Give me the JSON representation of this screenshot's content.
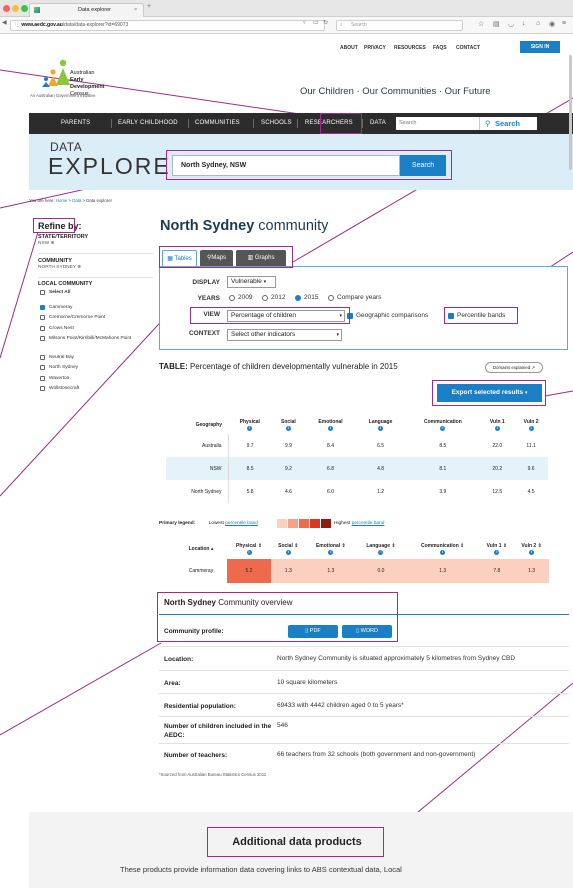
{
  "browser": {
    "tab_title": "Data explorer",
    "url": "www.aedc.gov.au/data/data-explorer?id=69073",
    "url_host": "www.aedc.gov.au",
    "url_path": "/data/data-explorer?id=69073",
    "search_placeholder": "Search"
  },
  "site": {
    "logo_lines": [
      "Australian",
      "Early",
      "Development",
      "Census"
    ],
    "gov_initiative": "An Australian Government Initiative",
    "top_links": [
      "ABOUT",
      "PRIVACY",
      "RESOURCES",
      "FAQS",
      "CONTACT"
    ],
    "sign_in": "SIGN IN",
    "tagline": "Our Children · Our Communities · Our Future",
    "nav": [
      "PARENTS",
      "EARLY CHILDHOOD",
      "COMMUNITIES",
      "SCHOOLS",
      "RESEARCHERS",
      "DATA"
    ],
    "nav_search_placeholder": "Search",
    "nav_search_button": "Search"
  },
  "hero": {
    "title_small": "DATA",
    "title_large": "EXPLORER",
    "search_value": "North Sydney, NSW",
    "search_button": "Search"
  },
  "breadcrumb": {
    "prefix": "You are here:",
    "items": [
      "Home",
      "Data",
      "Data explorer"
    ],
    "sep": " > "
  },
  "sidebar": {
    "title": "Refine by:",
    "state_label": "STATE/TERRITORY",
    "state_value": "NSW",
    "community_label": "COMMUNITY",
    "community_value": "NORTH SYDNEY",
    "local_label": "LOCAL COMMUNITY",
    "local_items": [
      {
        "label": "Select All",
        "checked": false
      },
      {
        "label": "Cammeray",
        "checked": true
      },
      {
        "label": "Cremorne/Cremorne Point",
        "checked": false
      },
      {
        "label": "Crows Nest",
        "checked": false
      },
      {
        "label": "Milsons Point/Kirribilli/McMahons Point",
        "checked": false
      },
      {
        "label": "Neutral Bay",
        "checked": false
      },
      {
        "label": "North Sydney",
        "checked": false
      },
      {
        "label": "Waverton",
        "checked": false
      },
      {
        "label": "Wollstonecraft",
        "checked": false
      }
    ]
  },
  "main": {
    "title_bold": "North Sydney",
    "title_rest": " community",
    "view_tabs": [
      {
        "label": "Tables",
        "icon": "table-icon",
        "active": true
      },
      {
        "label": "Maps",
        "icon": "map-pin-icon",
        "active": false
      },
      {
        "label": "Graphs",
        "icon": "bar-chart-icon",
        "active": false
      }
    ],
    "filters": {
      "display_label": "DISPLAY",
      "display_value": "Vulnerable",
      "years_label": "YEARS",
      "years": [
        {
          "label": "2009",
          "selected": false
        },
        {
          "label": "2012",
          "selected": false
        },
        {
          "label": "2015",
          "selected": true
        },
        {
          "label": "Compare years",
          "selected": false
        }
      ],
      "view_label": "VIEW",
      "view_value": "Percentage of children",
      "geo_comparisons": "Geographic comparisons",
      "geo_checked": true,
      "percentile_bands": "Percentile bands",
      "percentile_checked": true,
      "context_label": "CONTEXT",
      "context_value": "Select other indicators"
    },
    "table_label": "TABLE:",
    "table_title": "Percentage of children developmentally vulnerable in 2015",
    "domains_explained": "Domains explained",
    "export_button": "Export selected results",
    "table1": {
      "columns": [
        "Geography",
        "Physical",
        "Social",
        "Emotional",
        "Language",
        "Communication",
        "Vuln 1",
        "Vuln 2"
      ],
      "rows": [
        {
          "geo": "Australia",
          "values": [
            "9.7",
            "9.9",
            "8.4",
            "6.5",
            "8.5",
            "22.0",
            "11.1"
          ]
        },
        {
          "geo": "NSW",
          "values": [
            "8.5",
            "9.2",
            "6.8",
            "4.8",
            "8.1",
            "20.2",
            "9.6"
          ]
        },
        {
          "geo": "North Sydney",
          "values": [
            "5.8",
            "4.6",
            "6.0",
            "1.2",
            "3.9",
            "12.5",
            "4.5"
          ]
        }
      ]
    },
    "legend": {
      "prefix": "Primary legend:",
      "lowest": "Lowest",
      "link": "percentile band",
      "highest": "Highest",
      "swatches": [
        "#fbd0c0",
        "#f7a187",
        "#ef6a4c",
        "#d93622",
        "#8e1b12"
      ]
    },
    "table2": {
      "columns": [
        "Location",
        "Physical",
        "Social",
        "Emotional",
        "Language",
        "Communication",
        "Vuln 1",
        "Vuln 2"
      ],
      "row": {
        "location": "Cammeray",
        "values": [
          "5.2",
          "1.3",
          "1.3",
          "0.0",
          "1.3",
          "7.8",
          "1.3"
        ]
      }
    },
    "overview": {
      "title_bold": "North Sydney",
      "title_rest": " Community overview",
      "profile_label": "Community profile:",
      "pdf_button": "PDF",
      "word_button": "WORD",
      "rows": [
        {
          "key": "Location:",
          "value": "North Sydney Community is situated approximately 5 kilometres from Sydney CBD"
        },
        {
          "key": "Area:",
          "value": "10 square kilometers"
        },
        {
          "key": "Residential population:",
          "value": "69433 with 4442 children aged 0 to 5 years*"
        },
        {
          "key": "Number of children included in the AEDC:",
          "value": "546"
        },
        {
          "key": "Number of teachers:",
          "value": "66 teachers from 32 schools (both government and non-government)"
        }
      ],
      "footnote": "*Sourced from Australian Bureau Statistics Census 2011"
    },
    "additional": {
      "title": "Additional data products",
      "text": "These products provide information data covering links to ABS contextual data, Local"
    }
  },
  "colors": {
    "accent": "#1a7fc5",
    "annotation": "#a3298b",
    "nav_bg": "#2c2c2c",
    "hero_bg": "#dbeef7",
    "cell_hot": "#ef6a4c",
    "cell_warm": "#fbd0c0"
  }
}
